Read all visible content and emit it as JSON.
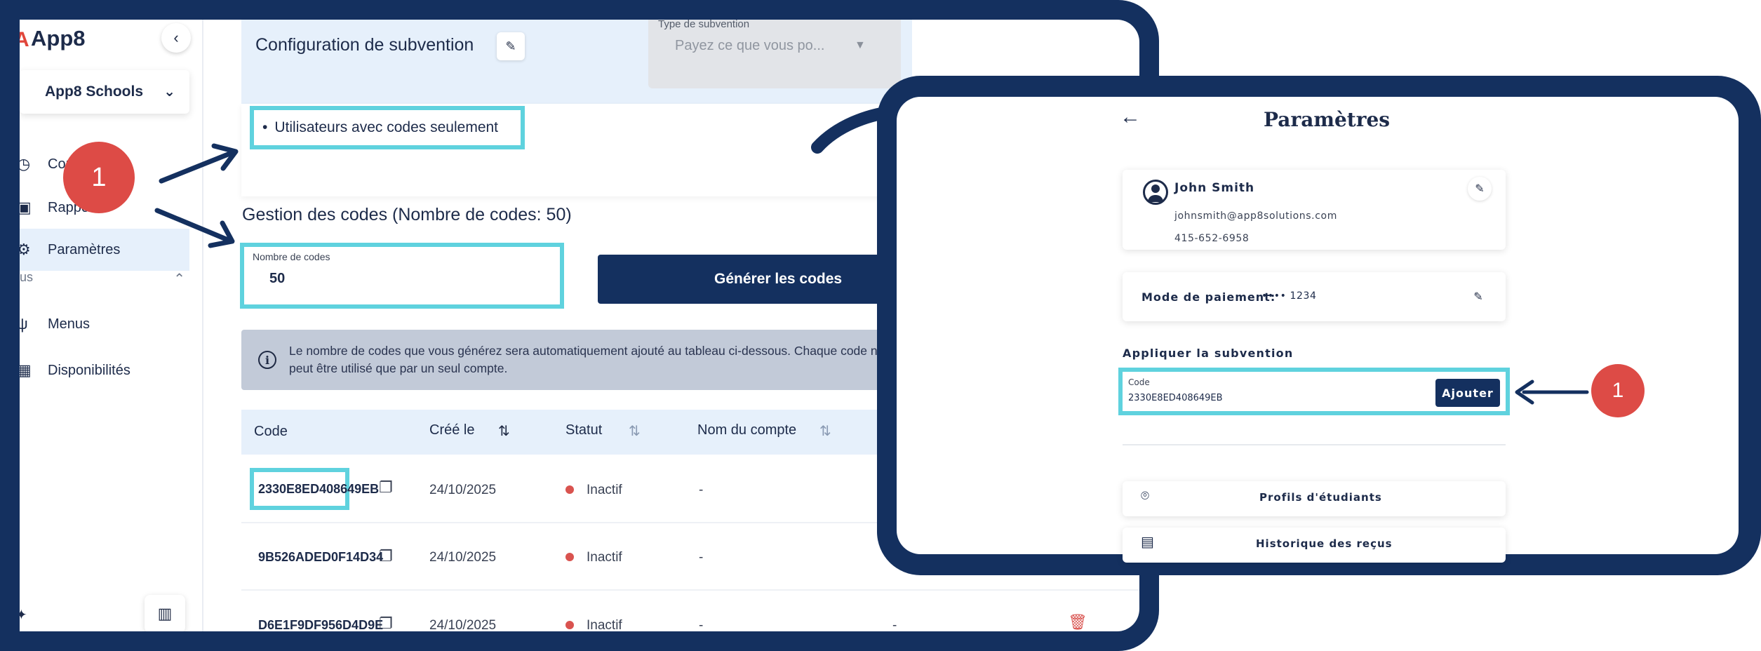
{
  "left": {
    "logo_mark": "A",
    "logo_text": "App8",
    "collapse_icon": "‹",
    "school": "App8 Schools",
    "nav": [
      {
        "label": "Commandes",
        "icon": "clock-icon"
      },
      {
        "label": "Rappo",
        "icon": "clipboard-icon"
      },
      {
        "label": "Paramètres",
        "icon": "gear-icon"
      },
      {
        "label": "Menus",
        "icon": "utensils-icon"
      },
      {
        "label": "Disponibilités",
        "icon": "calendar-icon"
      }
    ],
    "section_head": "us",
    "config": {
      "title": "Configuration de subvention",
      "type_label": "Type de subvention",
      "type_value": "Payez ce que vous po...",
      "users_option": "Utilisateurs avec codes seulement"
    },
    "codes": {
      "heading": "Gestion des codes (Nombre de codes: 50)",
      "count_label": "Nombre de codes",
      "count_value": "50",
      "generate_label": "Générer les codes",
      "info_text": "Le nombre de codes que vous générez sera automatiquement ajouté au tableau ci-dessous. Chaque code ne peut être utilisé que par un seul compte.",
      "columns": [
        "Code",
        "Créé le",
        "Statut",
        "Nom du compte"
      ],
      "rows": [
        {
          "code": "2330E8ED408649EB",
          "date": "24/10/2025",
          "status": "Inactif",
          "account": "-"
        },
        {
          "code": "9B526ADED0F14D34",
          "date": "24/10/2025",
          "status": "Inactif",
          "account": "-"
        },
        {
          "code": "D6E1F9DF956D4D9E",
          "date": "24/10/2025",
          "status": "Inactif",
          "account": "-",
          "extra": "-"
        }
      ]
    },
    "badge": "1"
  },
  "right": {
    "title": "Paramètres",
    "back_icon": "←",
    "user": {
      "name": "John Smith",
      "email": "johnsmith@app8solutions.com",
      "phone": "415-652-6958"
    },
    "payment": {
      "label": "Mode de paiement:",
      "mask": "•••• 1234"
    },
    "apply": {
      "heading": "Appliquer la subvention",
      "input_label": "Code",
      "input_value": "2330E8ED408649EB",
      "button": "Ajouter"
    },
    "menu": [
      {
        "label": "Profils d'étudiants",
        "icon": "location-pin-icon"
      },
      {
        "label": "Historique des reçus",
        "icon": "receipt-icon"
      }
    ],
    "badge": "1"
  },
  "colors": {
    "frame": "#14305f",
    "highlight": "#5fd2de",
    "badge": "#dd4b46",
    "accent_light": "#e6f0fb"
  }
}
